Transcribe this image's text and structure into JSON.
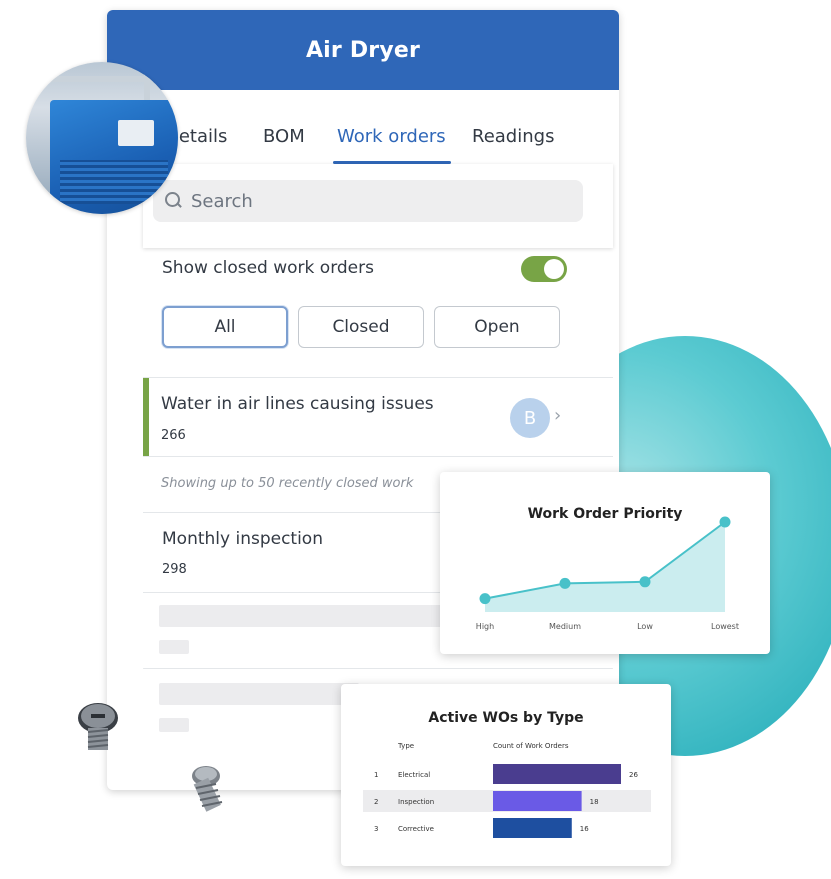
{
  "header": {
    "title": "Air Dryer"
  },
  "tabs": [
    {
      "label": "Details"
    },
    {
      "label": "BOM"
    },
    {
      "label": "Work orders"
    },
    {
      "label": "Readings"
    }
  ],
  "active_tab": "Work orders",
  "search": {
    "placeholder": "Search"
  },
  "filters": {
    "show_closed_label": "Show closed work orders",
    "show_closed_on": true,
    "segments": [
      {
        "label": "All"
      },
      {
        "label": "Closed"
      },
      {
        "label": "Open"
      }
    ],
    "selected_segment": "All"
  },
  "work_orders": [
    {
      "title": "Water in air lines causing issues",
      "number": "266",
      "assignee_initial": "B",
      "status_color": "#78a446"
    },
    {
      "title": "Monthly inspection",
      "number": "298"
    }
  ],
  "closed_note": "Showing up to 50 recently closed work",
  "colors": {
    "brand": "#2f67b8",
    "toggle_on": "#78a446",
    "teal": "#48c1c9"
  },
  "icons": [
    "search-icon",
    "chevron-right-icon",
    "avatar-circle",
    "screw-icon"
  ],
  "chart_data": [
    {
      "type": "area",
      "title": "Work Order Priority",
      "categories": [
        "High",
        "Medium",
        "Low",
        "Lowest"
      ],
      "values": [
        1,
        2,
        2.1,
        6
      ],
      "ylim": [
        0,
        6
      ],
      "grid": false,
      "color": "#48c1c9"
    },
    {
      "type": "bar",
      "title": "Active WOs by Type",
      "columns": [
        "Type",
        "Count of Work Orders"
      ],
      "rows": [
        {
          "index": "1",
          "category": "Electrical",
          "value": 26,
          "color": "#4a3d8f"
        },
        {
          "index": "2",
          "category": "Inspection",
          "value": 18,
          "color": "#6a5ae6"
        },
        {
          "index": "3",
          "category": "Corrective",
          "value": 16,
          "color": "#1e4fa0"
        }
      ],
      "xlim": [
        0,
        26
      ]
    }
  ]
}
